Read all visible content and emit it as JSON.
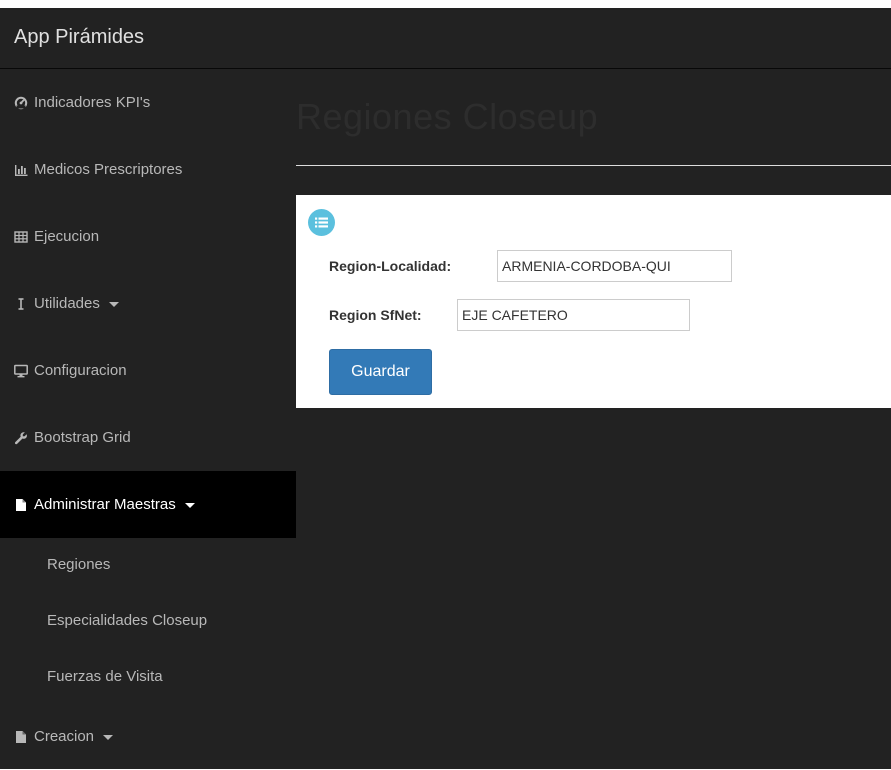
{
  "app": {
    "brand": "App Pirámides"
  },
  "sidebar": {
    "items": [
      {
        "label": "Indicadores KPI's",
        "icon": "dashboard-icon"
      },
      {
        "label": "Medicos Prescriptores",
        "icon": "bar-chart-icon"
      },
      {
        "label": "Ejecucion",
        "icon": "table-icon"
      },
      {
        "label": "Utilidades",
        "icon": "text-height-icon",
        "has_caret": true
      },
      {
        "label": "Configuracion",
        "icon": "desktop-icon"
      },
      {
        "label": "Bootstrap Grid",
        "icon": "wrench-icon"
      },
      {
        "label": "Administrar Maestras",
        "icon": "file-icon",
        "has_caret": true,
        "active": true
      },
      {
        "label": "Creacion",
        "icon": "file-icon",
        "has_caret": true
      }
    ],
    "submenu": [
      {
        "label": "Regiones"
      },
      {
        "label": "Especialidades Closeup"
      },
      {
        "label": "Fuerzas de Visita"
      }
    ]
  },
  "main": {
    "title": "Regiones Closeup",
    "form": {
      "badge_icon": "list-icon",
      "region_localidad_label": "Region-Localidad:",
      "region_localidad_value": "ARMENIA-CORDOBA-QUI",
      "region_sfnet_label": "Region SfNet:",
      "region_sfnet_value": "EJE CAFETERO",
      "save_label": "Guardar"
    }
  },
  "colors": {
    "sidebar_bg": "#222222",
    "active_bg": "#000000",
    "nav_text": "#b8b8b8",
    "primary": "#337ab7",
    "info": "#5bc0de"
  }
}
